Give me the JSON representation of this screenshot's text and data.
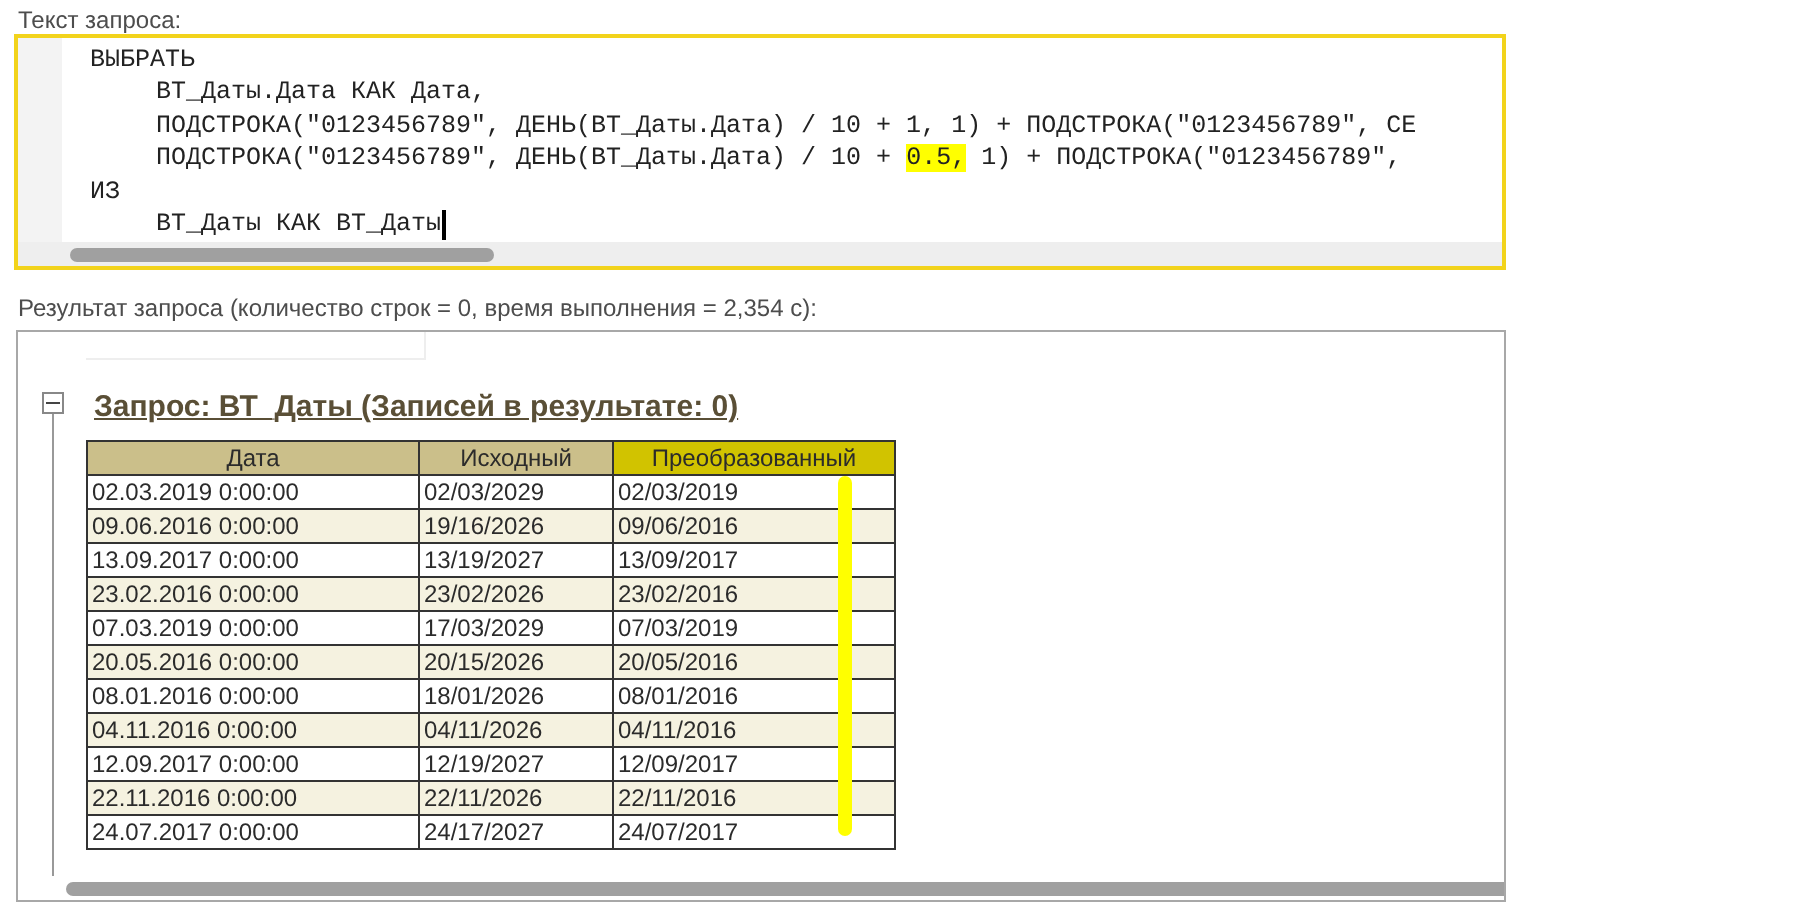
{
  "query_label": "Текст запроса:",
  "query_blocks": [
    {
      "keyword": "ВЫБРАТЬ",
      "children": [
        {
          "segments": [
            {
              "text": "ВТ_Даты.Дата КАК Дата,",
              "highlighted": false
            }
          ]
        },
        {
          "segments": [
            {
              "text": "ПОДСТРОКА(\"0123456789\", ДЕНЬ(ВТ_Даты.Дата) / 10 + 1, 1) + ПОДСТРОКА(\"0123456789\", СЕ",
              "highlighted": false
            }
          ]
        },
        {
          "segments": [
            {
              "text": "ПОДСТРОКА(\"0123456789\", ДЕНЬ(ВТ_Даты.Дата) / 10 + ",
              "highlighted": false
            },
            {
              "text": "0.5,",
              "highlighted": true
            },
            {
              "text": " 1) + ПОДСТРОКА(\"0123456789\",",
              "highlighted": false
            }
          ]
        }
      ]
    },
    {
      "keyword": "ИЗ",
      "children": [
        {
          "segments": [
            {
              "text": "ВТ_Даты КАК ВТ_Даты",
              "highlighted": false
            }
          ]
        }
      ]
    }
  ],
  "result_label": "Результат запроса (количество строк = 0, время выполнения = 2,354 с):",
  "result": {
    "expanded": true,
    "title": "Запрос: ВТ_Даты (Записей в результате: 0)",
    "columns": [
      {
        "label": "Дата",
        "highlighted": false
      },
      {
        "label": "Исходный",
        "highlighted": false
      },
      {
        "label": "Преобразованный",
        "highlighted": true
      }
    ],
    "rows": [
      [
        "02.03.2019 0:00:00",
        "02/03/2029",
        "02/03/2019"
      ],
      [
        "09.06.2016 0:00:00",
        "19/16/2026",
        "09/06/2016"
      ],
      [
        "13.09.2017 0:00:00",
        "13/19/2027",
        "13/09/2017"
      ],
      [
        "23.02.2016 0:00:00",
        "23/02/2026",
        "23/02/2016"
      ],
      [
        "07.03.2019 0:00:00",
        "17/03/2029",
        "07/03/2019"
      ],
      [
        "20.05.2016 0:00:00",
        "20/15/2026",
        "20/05/2016"
      ],
      [
        "08.01.2016 0:00:00",
        "18/01/2026",
        "08/01/2016"
      ],
      [
        "04.11.2016 0:00:00",
        "04/11/2026",
        "04/11/2016"
      ],
      [
        "12.09.2017 0:00:00",
        "12/19/2027",
        "12/09/2017"
      ],
      [
        "22.11.2016 0:00:00",
        "22/11/2026",
        "22/11/2016"
      ],
      [
        "24.07.2017 0:00:00",
        "24/17/2027",
        "24/07/2017"
      ]
    ]
  }
}
